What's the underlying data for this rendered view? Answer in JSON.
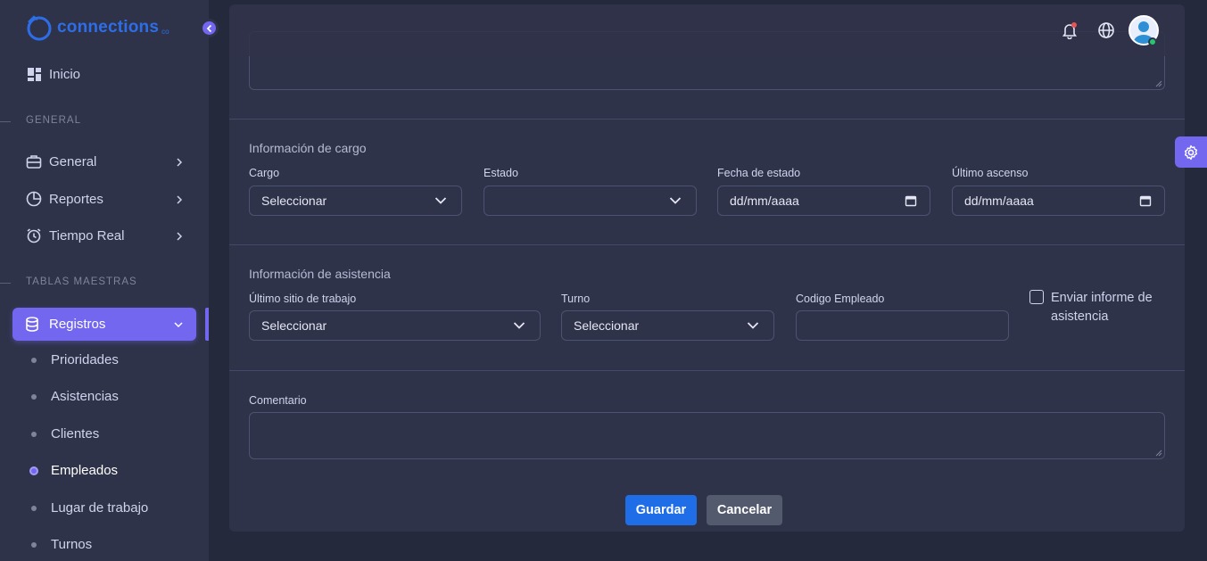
{
  "app": {
    "logo_text": "connections",
    "logo_sub": "co"
  },
  "sidebar": {
    "home": "Inicio",
    "section_general": "GENERAL",
    "general": "General",
    "reportes": "Reportes",
    "tiempo_real": "Tiempo Real",
    "section_tablas": "TABLAS MAESTRAS",
    "registros": "Registros",
    "sub_items": [
      "Prioridades",
      "Asistencias",
      "Clientes",
      "Empleados",
      "Lugar de trabajo",
      "Turnos"
    ],
    "active_sub_item": "Empleados"
  },
  "form": {
    "cargo_section": {
      "title": "Información de cargo",
      "cargo_label": "Cargo",
      "cargo_value": "Seleccionar",
      "estado_label": "Estado",
      "estado_value": "",
      "fecha_estado_label": "Fecha de estado",
      "fecha_estado_value": "dd/mm/aaaa",
      "ultimo_ascenso_label": "Último ascenso",
      "ultimo_ascenso_value": "dd/mm/aaaa"
    },
    "asistencia_section": {
      "title": "Información de asistencia",
      "sitio_label": "Último sitio de trabajo",
      "sitio_value": "Seleccionar",
      "turno_label": "Turno",
      "turno_value": "Seleccionar",
      "codigo_label": "Codigo Empleado",
      "codigo_value": "",
      "enviar_label": "Enviar informe de asistencia",
      "enviar_checked": false
    },
    "comentario_label": "Comentario",
    "comentario_value": "",
    "save_label": "Guardar",
    "cancel_label": "Cancelar"
  },
  "colors": {
    "accent": "#7367f0",
    "primary_button": "#1f6ee8",
    "secondary_button": "#535a6e",
    "notification_dot": "#ea5455",
    "online": "#28c76f"
  }
}
